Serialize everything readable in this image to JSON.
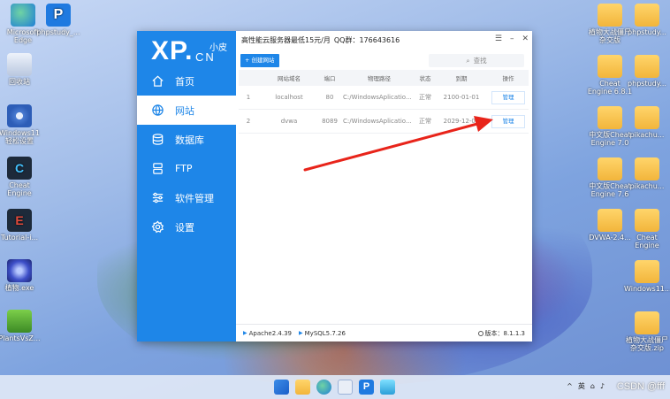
{
  "desktop": {
    "left_icons": [
      {
        "label": "Microsoft Edge",
        "kind": "edge"
      },
      {
        "label": "phpstudy_...",
        "kind": "p"
      },
      {
        "label": "回收站",
        "kind": "bin"
      },
      {
        "label": "Windows11 轻松设置",
        "kind": "gear"
      },
      {
        "label": "Cheat Engine",
        "kind": "ce"
      },
      {
        "label": "Tutorial-i...",
        "kind": "red"
      },
      {
        "label": "植物.exe",
        "kind": "star"
      },
      {
        "label": "PlantsVsZ...",
        "kind": "pvz"
      }
    ],
    "right_icons": [
      {
        "label": "植物大战僵尸杂交版",
        "kind": "folder"
      },
      {
        "label": "phpstudy...",
        "kind": "folder"
      },
      {
        "label": "Cheat Engine 6.8.1",
        "kind": "folder"
      },
      {
        "label": "phpstudy...",
        "kind": "folder-blue"
      },
      {
        "label": "中文版Cheat Engine 7.0",
        "kind": "folder"
      },
      {
        "label": "pikachu...",
        "kind": "folder"
      },
      {
        "label": "中文版Cheat Engine 7.6",
        "kind": "folder"
      },
      {
        "label": "pikachu...",
        "kind": "folder"
      },
      {
        "label": "DVWA-2.4...",
        "kind": "folder"
      },
      {
        "label": "Cheat Engine",
        "kind": "folder"
      },
      {
        "label": "Windows11...",
        "kind": "folder-blue"
      },
      {
        "label": "植物大战僵尸杂交版.zip",
        "kind": "folder"
      }
    ]
  },
  "window": {
    "logo_main": "XP.",
    "logo_small": "小皮",
    "logo_cn": "CN",
    "title": "高性能云服务器最低15元/月",
    "qq": "QQ群：176643616",
    "nav": [
      {
        "label": "首页",
        "icon": "home-icon"
      },
      {
        "label": "网站",
        "icon": "globe-icon"
      },
      {
        "label": "数据库",
        "icon": "database-icon"
      },
      {
        "label": "FTP",
        "icon": "ftp-icon"
      },
      {
        "label": "软件管理",
        "icon": "sliders-icon"
      },
      {
        "label": "设置",
        "icon": "gear-icon"
      }
    ],
    "active_nav": "网站",
    "add_site_label": "创建网站",
    "search_label": "查找",
    "columns": [
      "",
      "网站域名",
      "端口",
      "物理路径",
      "状态",
      "到期",
      "操作"
    ],
    "rows": [
      {
        "index": "1",
        "domain": "localhost",
        "port": "80",
        "path": "C:/WindowsAplicatio...",
        "status": "正常",
        "expire": "2100-01-01",
        "action": "管理"
      },
      {
        "index": "2",
        "domain": "dvwa",
        "port": "8089",
        "path": "C:/WindowsAplicatio...",
        "status": "正常",
        "expire": "2029-12-08",
        "action": "管理"
      }
    ],
    "footer": {
      "apache": "Apache2.4.39",
      "mysql": "MySQL5.7.26",
      "version": "版本：8.1.1.3"
    }
  },
  "taskbar": {
    "tray_lang": "英",
    "watermark": "CSDN @fff"
  },
  "colors": {
    "accent": "#1e86e8",
    "arrow": "#e8241a"
  }
}
